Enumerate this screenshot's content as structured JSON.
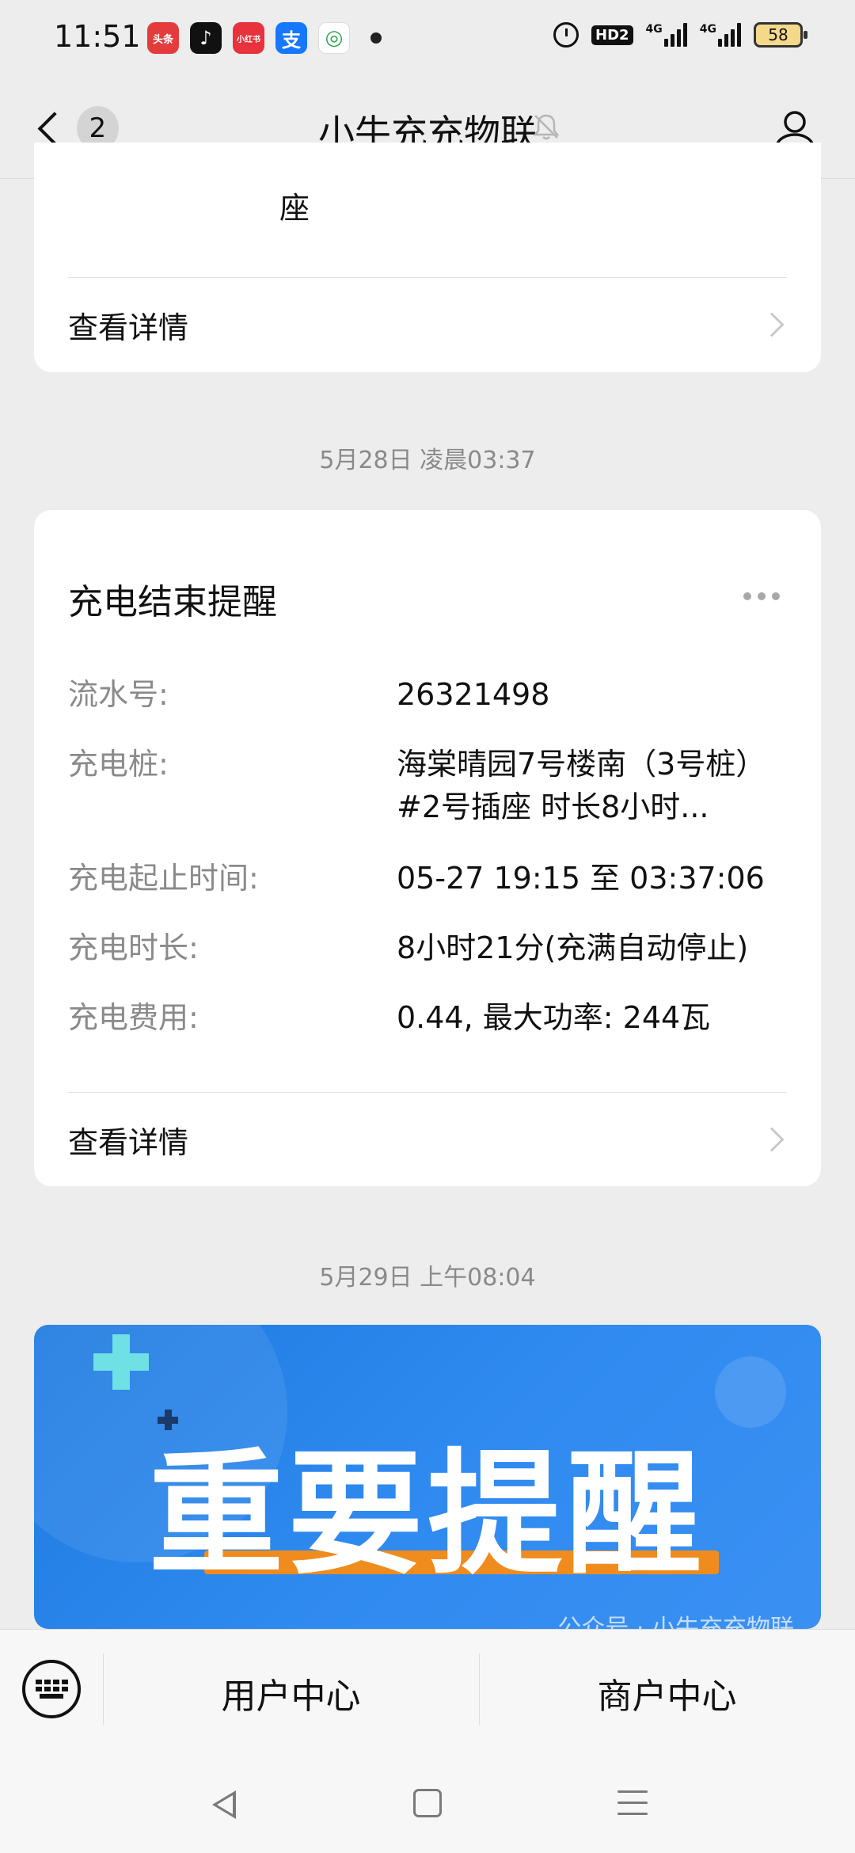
{
  "status_bar": {
    "time": "11:51",
    "app_icons": [
      {
        "name": "toutiao-icon",
        "label": "头条",
        "color": "#e43c3c"
      },
      {
        "name": "tiktok-icon",
        "label": "♪",
        "color": "#111111"
      },
      {
        "name": "xiaohongshu-icon",
        "label": "小红书",
        "color": "#e8323c"
      },
      {
        "name": "alipay-icon",
        "label": "支",
        "color": "#1677ff"
      },
      {
        "name": "china-mobile-icon",
        "label": "◎",
        "color": "#2fa84f"
      }
    ],
    "hd": "HD2",
    "net1": "4G",
    "net2": "4G",
    "battery": "58"
  },
  "nav": {
    "back_count": "2",
    "title": "小牛充充物联"
  },
  "top_card": {
    "fragment": "座",
    "detail_label": "查看详情"
  },
  "timestamps": [
    "5月28日 凌晨03:37",
    "5月29日 上午08:04"
  ],
  "main_card": {
    "title": "充电结束提醒",
    "fields": [
      {
        "label": "流水号:",
        "value": "26321498"
      },
      {
        "label": "充电桩:",
        "value": "海棠晴园7号楼南（3号桩）",
        "value2": "#2号插座 时长8小时..."
      },
      {
        "label": "充电起止时间:",
        "value": "05-27 19:15 至 03:37:06"
      },
      {
        "label": "充电时长:",
        "value": "8小时21分(充满自动停止)"
      },
      {
        "label": "充电费用:",
        "value": "0.44, 最大功率: 244瓦"
      }
    ],
    "detail_label": "查看详情"
  },
  "banner": {
    "title": "重要提醒",
    "watermark": "公众号 · 小牛充充物联"
  },
  "bottom_menu": {
    "items": [
      "用户中心",
      "商户中心"
    ]
  }
}
